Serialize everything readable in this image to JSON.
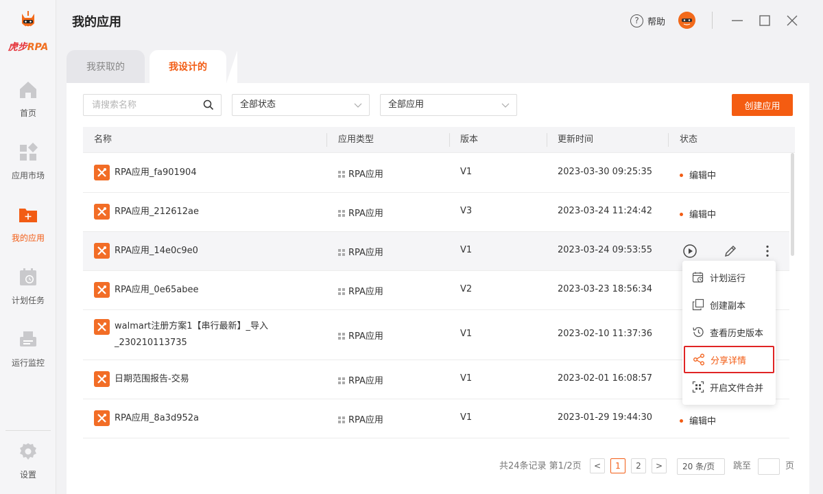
{
  "app": {
    "brand_a": "虎步",
    "brand_b": "RPA"
  },
  "sidebar": {
    "items": [
      {
        "label": "首页",
        "icon": "home-icon"
      },
      {
        "label": "应用市场",
        "icon": "app-market-icon"
      },
      {
        "label": "我的应用",
        "icon": "my-apps-folder-icon"
      },
      {
        "label": "计划任务",
        "icon": "calendar-clock-icon"
      },
      {
        "label": "运行监控",
        "icon": "monitor-printer-icon"
      }
    ],
    "settings_label": "设置"
  },
  "header": {
    "title": "我的应用",
    "help_label": "帮助",
    "help_glyph": "?"
  },
  "tabs": [
    {
      "label": "我获取的"
    },
    {
      "label": "我设计的"
    }
  ],
  "toolbar": {
    "search_placeholder": "请搜索名称",
    "status_filter": "全部状态",
    "app_filter": "全部应用",
    "create_label": "创建应用"
  },
  "table": {
    "columns": [
      "名称",
      "应用类型",
      "版本",
      "更新时间",
      "状态"
    ],
    "rows": [
      {
        "name": "RPA应用_fa901904",
        "type": "RPA应用",
        "version": "V1",
        "updated": "2023-03-30 09:25:35",
        "status": "编辑中"
      },
      {
        "name": "RPA应用_212612ae",
        "type": "RPA应用",
        "version": "V3",
        "updated": "2023-03-24 11:24:42",
        "status": "编辑中"
      },
      {
        "name": "RPA应用_14e0c9e0",
        "type": "RPA应用",
        "version": "V1",
        "updated": "2023-03-24 09:53:55",
        "status": ""
      },
      {
        "name": "RPA应用_0e65abee",
        "type": "RPA应用",
        "version": "V2",
        "updated": "2023-03-23 18:56:34",
        "status": ""
      },
      {
        "name": "walmart注册方案1【串行最新】_导入",
        "name2": "_230210113735",
        "type": "RPA应用",
        "version": "V1",
        "updated": "2023-02-10 11:37:36",
        "status": ""
      },
      {
        "name": "日期范围报告-交易",
        "type": "RPA应用",
        "version": "V1",
        "updated": "2023-02-01 16:08:57",
        "status": ""
      },
      {
        "name": "RPA应用_8a3d952a",
        "type": "RPA应用",
        "version": "V1",
        "updated": "2023-01-29 19:44:30",
        "status": "编辑中"
      }
    ]
  },
  "context_menu": {
    "items": [
      {
        "label": "计划运行",
        "icon": "schedule-run-icon"
      },
      {
        "label": "创建副本",
        "icon": "copy-icon"
      },
      {
        "label": "查看历史版本",
        "icon": "history-icon"
      },
      {
        "label": "分享详情",
        "icon": "share-icon"
      },
      {
        "label": "开启文件合并",
        "icon": "merge-files-icon"
      }
    ]
  },
  "pagination": {
    "summary": "共24条记录 第1/2页",
    "prev": "<",
    "page1": "1",
    "page2": "2",
    "next": ">",
    "page_size": "20 条/页",
    "jump_label": "跳至",
    "page_suffix": "页"
  },
  "colors": {
    "accent": "#f45c11",
    "highlight_border": "#e02424"
  }
}
